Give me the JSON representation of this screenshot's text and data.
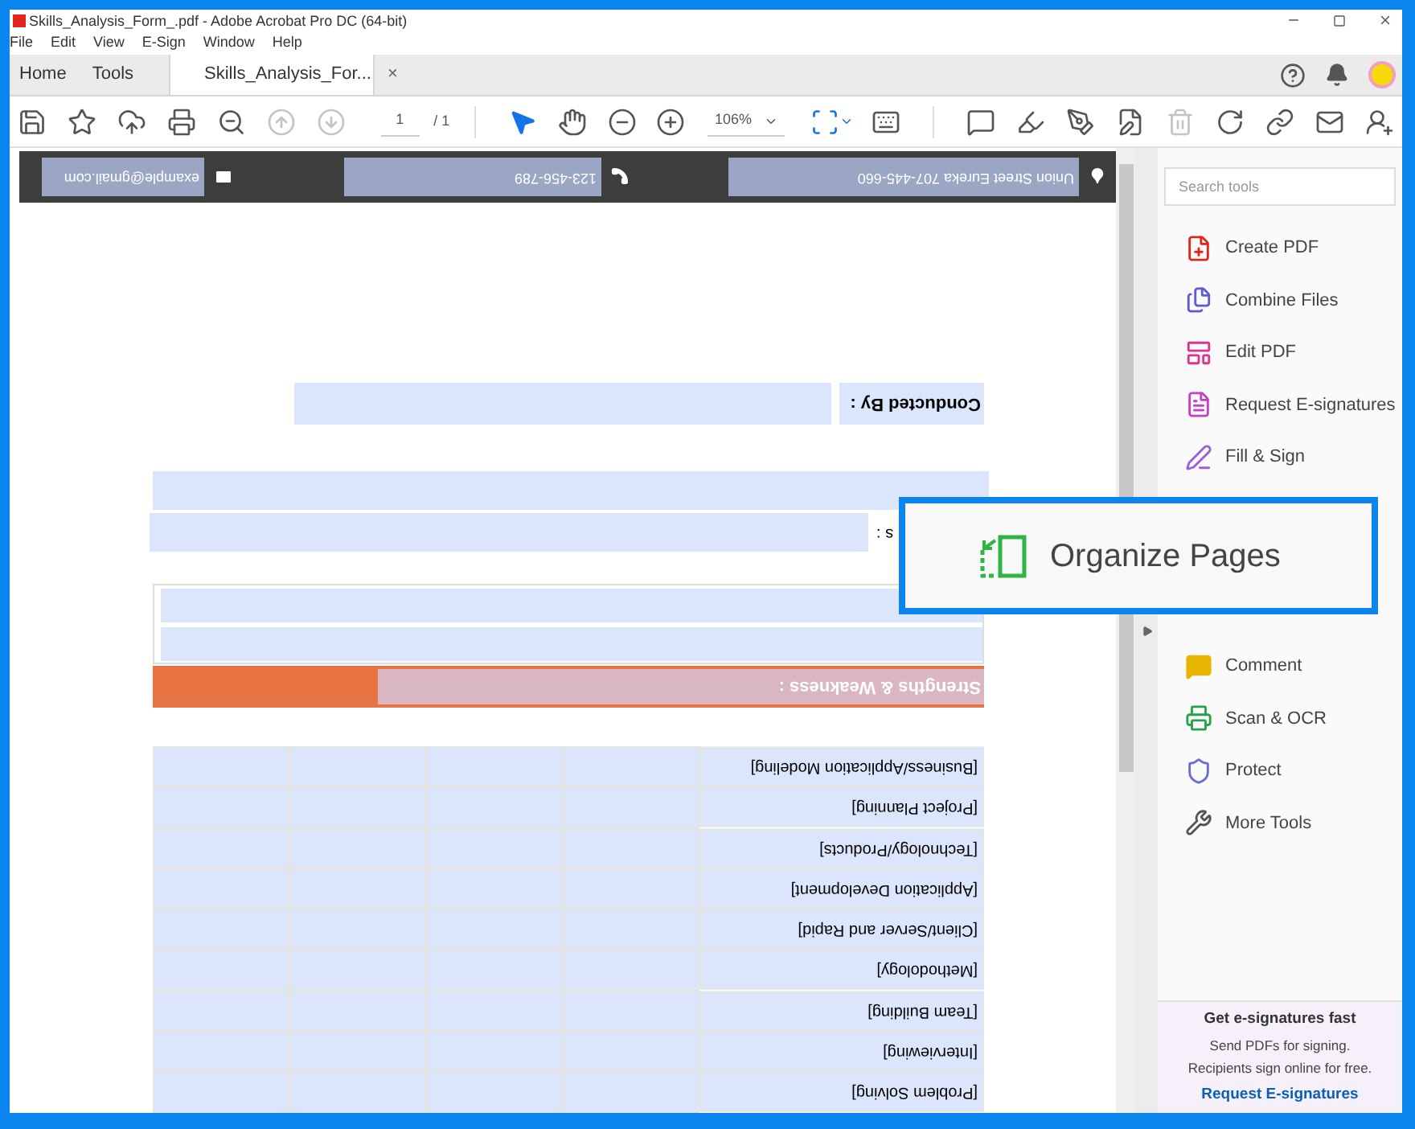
{
  "window": {
    "title": "Skills_Analysis_Form_.pdf - Adobe Acrobat Pro DC (64-bit)"
  },
  "menu": [
    "File",
    "Edit",
    "View",
    "E-Sign",
    "Window",
    "Help"
  ],
  "tabs": [
    {
      "label": "Home",
      "selected": false
    },
    {
      "label": "Tools",
      "selected": false
    },
    {
      "label": "Skills_Analysis_For...",
      "selected": true,
      "close": "×"
    }
  ],
  "toolbar": {
    "file_buttons": [
      {
        "kind": "save",
        "disabled": false
      },
      {
        "kind": "bookmark",
        "disabled": false
      },
      {
        "kind": "upload",
        "disabled": false
      },
      {
        "kind": "print",
        "disabled": false
      },
      {
        "kind": "zoom-search",
        "disabled": false
      },
      {
        "kind": "prev-page",
        "disabled": true
      },
      {
        "kind": "next-page",
        "disabled": true
      }
    ],
    "page_number": "1",
    "page_count": "/ 1",
    "modes": [
      {
        "kind": "select",
        "selected": true
      },
      {
        "kind": "hand",
        "selected": false
      }
    ],
    "zoom_buttons": [
      {
        "kind": "zoom-out",
        "disabled": false
      },
      {
        "kind": "zoom-in",
        "disabled": false
      }
    ],
    "zoom": "106%",
    "view_buttons": [
      {
        "kind": "fit",
        "disabled": false
      },
      {
        "kind": "scroll",
        "disabled": false
      }
    ],
    "edit_buttons": [
      {
        "kind": "comment",
        "disabled": false
      },
      {
        "kind": "highlight",
        "disabled": false
      },
      {
        "kind": "sign",
        "disabled": false
      },
      {
        "kind": "edit-page",
        "disabled": false
      },
      {
        "kind": "delete",
        "disabled": true
      },
      {
        "kind": "rotate",
        "disabled": false
      }
    ],
    "share_buttons": [
      {
        "kind": "link",
        "disabled": false
      },
      {
        "kind": "mail",
        "disabled": false
      },
      {
        "kind": "add-user",
        "disabled": false
      }
    ]
  },
  "document": {
    "contact_bar": [
      {
        "kind": "address",
        "text": "Union Street Eureka 707-445-660"
      },
      {
        "kind": "phone",
        "text": "123-456-789"
      },
      {
        "kind": "email",
        "text": "example@gmail.com"
      }
    ],
    "conducted_by": "Conducted By :",
    "partial_label": "s :",
    "section_heading": "Strengths & Weakness :",
    "skills": [
      "[Business/Application Modeling]",
      "[Project Planning]",
      "[Technology/Products]",
      "[Application Development]",
      "[Client/Server and Rapid]",
      "[Methodology]",
      "[Team Building]",
      "[Interviewing]",
      "[Problem Solving]"
    ]
  },
  "tools_panel": {
    "search": {
      "placeholder": "Search tools"
    },
    "items_top": [
      {
        "kind": "create-pdf",
        "label": "Create PDF"
      },
      {
        "kind": "combine",
        "label": "Combine Files"
      },
      {
        "kind": "edit-pdf",
        "label": "Edit PDF"
      },
      {
        "kind": "request-sign",
        "label": "Request E-signatures"
      },
      {
        "kind": "fill-sign",
        "label": "Fill & Sign"
      }
    ],
    "items_bottom": [
      {
        "kind": "comment",
        "label": "Comment"
      },
      {
        "kind": "scan",
        "label": "Scan & OCR"
      },
      {
        "kind": "protect",
        "label": "Protect"
      },
      {
        "kind": "more",
        "label": "More Tools"
      }
    ],
    "promo": {
      "title": "Get e-signatures fast",
      "lines": [
        "Send PDFs for signing.",
        "Recipients sign online for free."
      ],
      "link": "Request E-signatures"
    }
  },
  "callout": {
    "label": "Organize Pages"
  }
}
